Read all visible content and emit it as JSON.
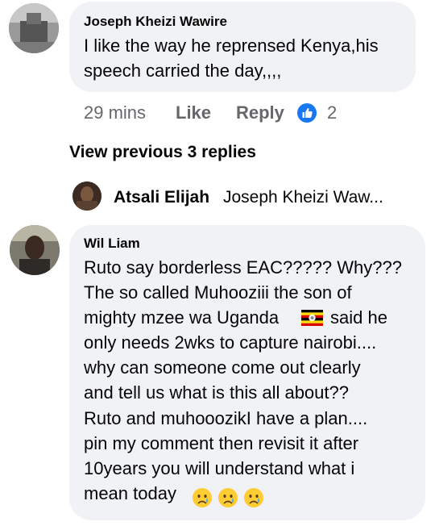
{
  "comment1": {
    "author": "Joseph Kheizi Wawire",
    "lines": [
      "I like the way he reprensed Kenya,his",
      "speech carried the day,,,,"
    ],
    "time": "29 mins",
    "like_label": "Like",
    "reply_label": "Reply",
    "reaction_count": "2"
  },
  "view_previous": "View previous 3 replies",
  "reply_preview": {
    "author": "Atsali Elijah",
    "snippet": "Joseph Kheizi Waw..."
  },
  "comment2": {
    "author": "Wil Liam",
    "lines": [
      "Ruto say borderless EAC????? Why???",
      "The so called Muhooziii  the son of",
      "mighty mzee wa Uganda",
      "said he",
      "only needs 2wks to capture nairobi....",
      "why can someone come out clearly",
      "and tell us what is this all about??",
      "Ruto and muhooozikI have a plan....",
      "pin my comment then revisit it after",
      "10years you will understand what i",
      "mean today"
    ]
  },
  "colors": {
    "bubble": "#f0f2f5",
    "like_blue": "#1877f2",
    "muted": "#65676b"
  }
}
